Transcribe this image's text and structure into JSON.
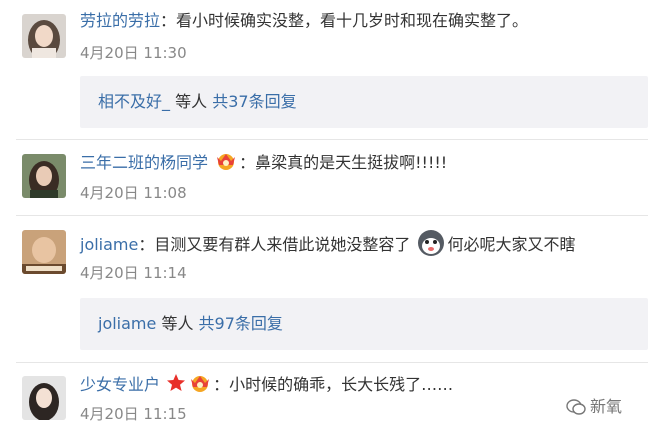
{
  "comments": [
    {
      "user": "劳拉的劳拉",
      "sep": "：",
      "text": "看小时候确实没整，看十几岁时和现在确实整了。",
      "time": "4月20日 11:30",
      "reply": {
        "user": "相不及好_",
        "mid": " 等人 ",
        "count": "共37条回复"
      }
    },
    {
      "user": "三年二班的杨同学",
      "sep": "：",
      "text": "鼻梁真的是天生挺拔啊!!!!!",
      "time": "4月20日 11:08"
    },
    {
      "user": "joliame",
      "sep": "：",
      "text": "目测又要有群人来借此说她没整容了",
      "text2": "何必呢大家又不瞎",
      "time": "4月20日 11:14",
      "reply": {
        "user": "joliame",
        "mid": " 等人 ",
        "count": "共97条回复"
      }
    },
    {
      "user": "少女专业户",
      "sep": "：",
      "text": "小时候的确乖，长大长残了……",
      "time": "4月20日 11:15"
    }
  ],
  "watermark": "新氧",
  "colors": {
    "username": "#3a6ea8",
    "time": "#888888",
    "reply_bg": "#f2f2f5"
  }
}
